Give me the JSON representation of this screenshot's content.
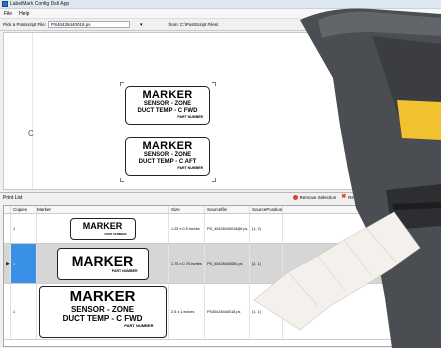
{
  "window": {
    "title": "LabelMark Config Dstl App"
  },
  "menu": [
    "File",
    "Help"
  ],
  "toolbar": {
    "pick_label": "Pick a Postscript File:",
    "pick_value": "PS40428440018.ps",
    "from_label": "from: C:\\PostScript Files\\",
    "zoom_value": "100%",
    "add_label": "Add to Print List"
  },
  "preview": {
    "labels": [
      {
        "title": "MARKER",
        "lines": [
          "SENSOR - ZONE",
          "DUCT TEMP - C FWD"
        ],
        "pn": "PART NUMBER"
      },
      {
        "title": "MARKER",
        "lines": [
          "SENSOR - ZONE",
          "DUCT TEMP - C AFT"
        ],
        "pn": "PART NUMBER"
      }
    ],
    "cursor": "C"
  },
  "print_list": {
    "title": "Print List",
    "remove_selection": "Remove Selection",
    "remove_all": "Remove All",
    "columns": [
      "Copies",
      "Marker",
      "Size",
      "Sourcefile",
      "SourcePosition"
    ],
    "rows": [
      {
        "copies": "1",
        "marker_title": "MARKER",
        "marker_lines": [],
        "marker_pn": "PART NUMBER",
        "size": "1.25 x 0.5 inches",
        "source": "PS_40428440018@f.ps",
        "position": "(1, 2)",
        "selected": false
      },
      {
        "copies": "1",
        "marker_title": "MARKER",
        "marker_lines": [],
        "marker_pn": "PART NUMBER",
        "size": "1.75 x 0.75 inches",
        "source": "PS_40428440050.ps",
        "position": "(2, 1)",
        "selected": true
      },
      {
        "copies": "1",
        "marker_title": "MARKER",
        "marker_lines": [
          "SENSOR - ZONE",
          "DUCT TEMP - C FWD"
        ],
        "marker_pn": "PART NUMBER",
        "size": "2.5 x 1 inches",
        "source": "PS40428440018.ps",
        "position": "(1, 1)",
        "selected": false
      }
    ]
  },
  "colors": {
    "printer_body": "#4a4d52",
    "printer_accent": "#f2c230",
    "selection": "#3a8fe6"
  }
}
